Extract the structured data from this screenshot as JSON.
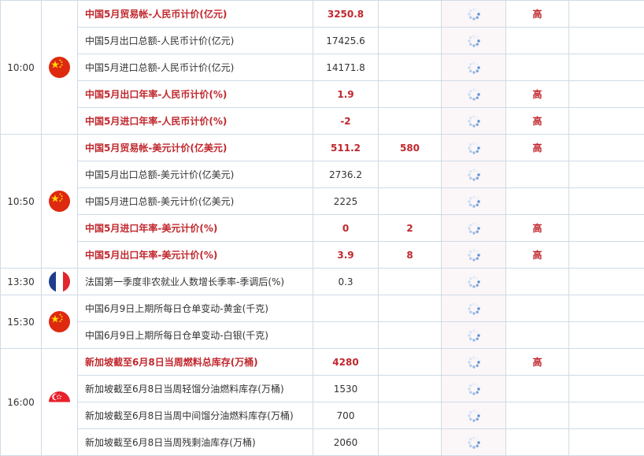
{
  "icons": {
    "flag_cn": "china-flag-icon",
    "flag_fr": "france-flag-icon",
    "flag_sg": "singapore-flag-icon",
    "loading": "loading-spinner-icon"
  },
  "colors": {
    "highlight": "#c0272d",
    "grid": "#cfdbe8",
    "load_cell_bg": "#fbf6f8"
  },
  "groups": [
    {
      "time": "10:00",
      "flag": "cn",
      "rows": [
        {
          "name": "中国5月贸易帐-人民币计价(亿元)",
          "actual": "3250.8",
          "forecast": "",
          "importance": "高",
          "highlight": true
        },
        {
          "name": "中国5月出口总额-人民币计价(亿元)",
          "actual": "17425.6",
          "forecast": "",
          "importance": "",
          "highlight": false
        },
        {
          "name": "中国5月进口总额-人民币计价(亿元)",
          "actual": "14171.8",
          "forecast": "",
          "importance": "",
          "highlight": false
        },
        {
          "name": "中国5月出口年率-人民币计价(%)",
          "actual": "1.9",
          "forecast": "",
          "importance": "高",
          "highlight": true
        },
        {
          "name": "中国5月进口年率-人民币计价(%)",
          "actual": "-2",
          "forecast": "",
          "importance": "高",
          "highlight": true
        }
      ]
    },
    {
      "time": "10:50",
      "flag": "cn",
      "rows": [
        {
          "name": "中国5月贸易帐-美元计价(亿美元)",
          "actual": "511.2",
          "forecast": "580",
          "importance": "高",
          "highlight": true
        },
        {
          "name": "中国5月出口总额-美元计价(亿美元)",
          "actual": "2736.2",
          "forecast": "",
          "importance": "",
          "highlight": false
        },
        {
          "name": "中国5月进口总额-美元计价(亿美元)",
          "actual": "2225",
          "forecast": "",
          "importance": "",
          "highlight": false
        },
        {
          "name": "中国5月进口年率-美元计价(%)",
          "actual": "0",
          "forecast": "2",
          "importance": "高",
          "highlight": true
        },
        {
          "name": "中国5月出口年率-美元计价(%)",
          "actual": "3.9",
          "forecast": "8",
          "importance": "高",
          "highlight": true
        }
      ]
    },
    {
      "time": "13:30",
      "flag": "fr",
      "rows": [
        {
          "name": "法国第一季度非农就业人数增长季率-季调后(%)",
          "actual": "0.3",
          "forecast": "",
          "importance": "",
          "highlight": false
        }
      ]
    },
    {
      "time": "15:30",
      "flag": "cn",
      "rows": [
        {
          "name": "中国6月9日上期所每日仓单变动-黄金(千克)",
          "actual": "",
          "forecast": "",
          "importance": "",
          "highlight": false
        },
        {
          "name": "中国6月9日上期所每日仓单变动-白银(千克)",
          "actual": "",
          "forecast": "",
          "importance": "",
          "highlight": false
        }
      ]
    },
    {
      "time": "16:00",
      "flag": "sg",
      "rows": [
        {
          "name": "新加坡截至6月8日当周燃料总库存(万桶)",
          "actual": "4280",
          "forecast": "",
          "importance": "高",
          "highlight": true
        },
        {
          "name": "新加坡截至6月8日当周轻馏分油燃料库存(万桶)",
          "actual": "1530",
          "forecast": "",
          "importance": "",
          "highlight": false
        },
        {
          "name": "新加坡截至6月8日当周中间馏分油燃料库存(万桶)",
          "actual": "700",
          "forecast": "",
          "importance": "",
          "highlight": false
        },
        {
          "name": "新加坡截至6月8日当周残剩油库存(万桶)",
          "actual": "2060",
          "forecast": "",
          "importance": "",
          "highlight": false
        }
      ]
    }
  ]
}
